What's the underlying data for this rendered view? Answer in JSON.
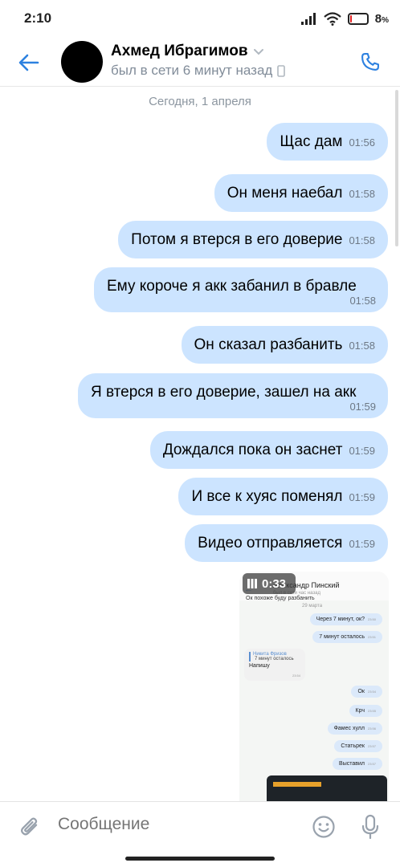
{
  "status_bar": {
    "time": "2:10",
    "battery_percent": "8",
    "battery_suffix": "%",
    "battery_level": 0.08
  },
  "header": {
    "contact_name": "Ахмед Ибрагимов",
    "contact_status": "был в сети 6 минут назад"
  },
  "date_separator": "Сегодня, 1 апреля",
  "messages": [
    {
      "text": "Щас дам",
      "time": "01:56"
    },
    {
      "text": "Он меня наебал",
      "time": "01:58"
    },
    {
      "text": "Потом я втерся в его доверие",
      "time": "01:58"
    },
    {
      "text": "Ему короче я акк забанил в бравле",
      "time": "01:58"
    },
    {
      "text": "Он сказал разбанить",
      "time": "01:58"
    },
    {
      "text": "Я втерся в его доверие, зашел на акк",
      "time": "01:59"
    },
    {
      "text": "Дождался пока он заснет",
      "time": "01:59"
    },
    {
      "text": "И все к хуяс поменял",
      "time": "01:59"
    },
    {
      "text": "Видео отправляется",
      "time": "01:59"
    }
  ],
  "video": {
    "duration": "0:33",
    "inner": {
      "name": "Александр Пинский",
      "sub": "был в сети час назад",
      "line_top": "Ок похоже буду разбанить",
      "date": "29 марта",
      "bubbles": [
        {
          "text": "Через 7 минут, ок?",
          "time": "23:50"
        },
        {
          "text": "7 минут осталось",
          "time": "23:51"
        },
        {
          "text": "Ок",
          "time": "23:54"
        },
        {
          "text": "Крч",
          "time": "23:55"
        },
        {
          "text": "Фамес хулл",
          "time": "23:56"
        },
        {
          "text": "Статьрек",
          "time": "23:57"
        },
        {
          "text": "Выставил",
          "time": "23:57"
        }
      ],
      "reply_author": "Никита Фризов",
      "reply_quote": "7 минут осталось",
      "reply_text": "Напишу",
      "reply_time": "23:54"
    }
  },
  "input": {
    "placeholder": "Сообщение"
  },
  "colors": {
    "accent": "#2d81e0",
    "bubble": "#cce4ff",
    "secondary_text": "#818c99"
  }
}
